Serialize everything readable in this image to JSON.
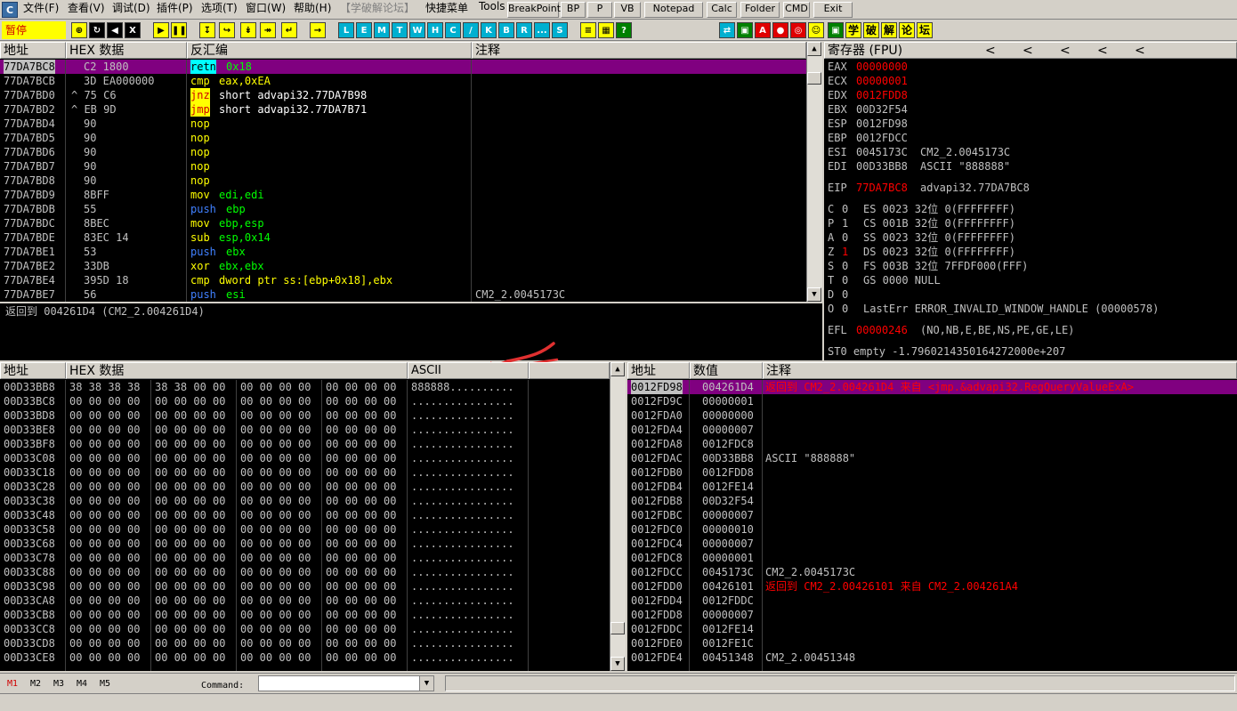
{
  "menu": {
    "items": [
      "文件(F)",
      "查看(V)",
      "调试(D)",
      "插件(P)",
      "选项(T)",
      "窗口(W)",
      "帮助(H)",
      "【学破解论坛】",
      "快捷菜单",
      "Tools"
    ],
    "buttons": [
      "BreakPoint",
      "BP",
      "P",
      "VB",
      "Notepad",
      "Calc",
      "Folder",
      "CMD",
      "Exit"
    ],
    "app_icon": "C"
  },
  "toolbar": {
    "status": "暂停",
    "letters": [
      "L",
      "E",
      "M",
      "T",
      "W",
      "H",
      "C",
      "/",
      "K",
      "B",
      "R",
      "...",
      "S"
    ],
    "cn": [
      "学",
      "破",
      "解",
      "论",
      "坛"
    ]
  },
  "cpu": {
    "headers": {
      "addr": "地址",
      "hex": "HEX 数据",
      "disasm": "反汇编",
      "comment": "注释"
    },
    "rows": [
      {
        "addr": "77DA7BC8",
        "hex": "C2 1800",
        "mnem": "retn",
        "ops": "0x18",
        "comment": "",
        "sel": true
      },
      {
        "addr": "77DA7BCB",
        "hex": "3D EA000000",
        "mnem": "cmp",
        "ops": "eax,0xEA",
        "comment": ""
      },
      {
        "addr": "77DA7BD0",
        "hex": "^ 75 C6",
        "mnem": "jnz",
        "ops": "short advapi32.77DA7B98",
        "comment": ""
      },
      {
        "addr": "77DA7BD2",
        "hex": "^ EB 9D",
        "mnem": "jmp",
        "ops": "short advapi32.77DA7B71",
        "comment": ""
      },
      {
        "addr": "77DA7BD4",
        "hex": "90",
        "mnem": "nop",
        "ops": "",
        "comment": ""
      },
      {
        "addr": "77DA7BD5",
        "hex": "90",
        "mnem": "nop",
        "ops": "",
        "comment": ""
      },
      {
        "addr": "77DA7BD6",
        "hex": "90",
        "mnem": "nop",
        "ops": "",
        "comment": ""
      },
      {
        "addr": "77DA7BD7",
        "hex": "90",
        "mnem": "nop",
        "ops": "",
        "comment": ""
      },
      {
        "addr": "77DA7BD8",
        "hex": "90",
        "mnem": "nop",
        "ops": "",
        "comment": ""
      },
      {
        "addr": "77DA7BD9",
        "hex": "8BFF",
        "mnem": "mov",
        "ops": "edi,edi",
        "comment": ""
      },
      {
        "addr": "77DA7BDB",
        "hex": "55",
        "mnem": "push",
        "ops": "ebp",
        "comment": ""
      },
      {
        "addr": "77DA7BDC",
        "hex": "8BEC",
        "mnem": "mov",
        "ops": "ebp,esp",
        "comment": ""
      },
      {
        "addr": "77DA7BDE",
        "hex": "83EC 14",
        "mnem": "sub",
        "ops": "esp,0x14",
        "comment": ""
      },
      {
        "addr": "77DA7BE1",
        "hex": "53",
        "mnem": "push",
        "ops": "ebx",
        "comment": ""
      },
      {
        "addr": "77DA7BE2",
        "hex": "33DB",
        "mnem": "xor",
        "ops": "ebx,ebx",
        "comment": ""
      },
      {
        "addr": "77DA7BE4",
        "hex": "395D 18",
        "mnem": "cmp",
        "ops": "dword ptr ss:[ebp+0x18],ebx",
        "comment": ""
      },
      {
        "addr": "77DA7BE7",
        "hex": "56",
        "mnem": "push",
        "ops": "esi",
        "comment": "CM2_2.0045173C"
      }
    ],
    "info": "返回到 004261D4 (CM2_2.004261D4)"
  },
  "registers": {
    "header": "寄存器 (FPU)",
    "nav": [
      "<",
      "<",
      "<",
      "<",
      "<"
    ],
    "gp": [
      {
        "name": "EAX",
        "value": "00000000",
        "changed": true,
        "extra": ""
      },
      {
        "name": "ECX",
        "value": "00000001",
        "changed": true,
        "extra": ""
      },
      {
        "name": "EDX",
        "value": "0012FDD8",
        "changed": true,
        "extra": ""
      },
      {
        "name": "EBX",
        "value": "00D32F54",
        "changed": false,
        "extra": ""
      },
      {
        "name": "ESP",
        "value": "0012FD98",
        "changed": false,
        "extra": ""
      },
      {
        "name": "EBP",
        "value": "0012FDCC",
        "changed": false,
        "extra": ""
      },
      {
        "name": "ESI",
        "value": "0045173C",
        "changed": false,
        "extra": "CM2_2.0045173C"
      },
      {
        "name": "EDI",
        "value": "00D33BB8",
        "changed": false,
        "extra": "ASCII \"888888\""
      }
    ],
    "eip": {
      "name": "EIP",
      "value": "77DA7BC8",
      "extra": "advapi32.77DA7BC8"
    },
    "flags": [
      {
        "f": "C",
        "v": "0",
        "red": false,
        "seg": "ES 0023 32位 0(FFFFFFFF)"
      },
      {
        "f": "P",
        "v": "1",
        "red": false,
        "seg": "CS 001B 32位 0(FFFFFFFF)"
      },
      {
        "f": "A",
        "v": "0",
        "red": false,
        "seg": "SS 0023 32位 0(FFFFFFFF)"
      },
      {
        "f": "Z",
        "v": "1",
        "red": true,
        "seg": "DS 0023 32位 0(FFFFFFFF)"
      },
      {
        "f": "S",
        "v": "0",
        "red": false,
        "seg": "FS 003B 32位 7FFDF000(FFF)"
      },
      {
        "f": "T",
        "v": "0",
        "red": false,
        "seg": "GS 0000 NULL"
      },
      {
        "f": "D",
        "v": "0",
        "red": false,
        "seg": ""
      },
      {
        "f": "O",
        "v": "0",
        "red": false,
        "seg": "LastErr ERROR_INVALID_WINDOW_HANDLE (00000578)"
      }
    ],
    "efl": {
      "name": "EFL",
      "value": "00000246",
      "extra": "(NO,NB,E,BE,NS,PE,GE,LE)"
    },
    "st0": "ST0 empty -1.7960214350164272000e+207"
  },
  "dump": {
    "headers": {
      "addr": "地址",
      "hex": "HEX 数据",
      "ascii": "ASCII"
    },
    "rows": [
      {
        "addr": "00D33BB8",
        "hex": [
          "38 38 38 38",
          "38 38 00 00",
          "00 00 00 00",
          "00 00 00 00"
        ],
        "ascii": "888888.........."
      },
      {
        "addr": "00D33BC8",
        "hex": [
          "00 00 00 00",
          "00 00 00 00",
          "00 00 00 00",
          "00 00 00 00"
        ],
        "ascii": "................"
      },
      {
        "addr": "00D33BD8",
        "hex": [
          "00 00 00 00",
          "00 00 00 00",
          "00 00 00 00",
          "00 00 00 00"
        ],
        "ascii": "................"
      },
      {
        "addr": "00D33BE8",
        "hex": [
          "00 00 00 00",
          "00 00 00 00",
          "00 00 00 00",
          "00 00 00 00"
        ],
        "ascii": "................"
      },
      {
        "addr": "00D33BF8",
        "hex": [
          "00 00 00 00",
          "00 00 00 00",
          "00 00 00 00",
          "00 00 00 00"
        ],
        "ascii": "................"
      },
      {
        "addr": "00D33C08",
        "hex": [
          "00 00 00 00",
          "00 00 00 00",
          "00 00 00 00",
          "00 00 00 00"
        ],
        "ascii": "................"
      },
      {
        "addr": "00D33C18",
        "hex": [
          "00 00 00 00",
          "00 00 00 00",
          "00 00 00 00",
          "00 00 00 00"
        ],
        "ascii": "................"
      },
      {
        "addr": "00D33C28",
        "hex": [
          "00 00 00 00",
          "00 00 00 00",
          "00 00 00 00",
          "00 00 00 00"
        ],
        "ascii": "................"
      },
      {
        "addr": "00D33C38",
        "hex": [
          "00 00 00 00",
          "00 00 00 00",
          "00 00 00 00",
          "00 00 00 00"
        ],
        "ascii": "................"
      },
      {
        "addr": "00D33C48",
        "hex": [
          "00 00 00 00",
          "00 00 00 00",
          "00 00 00 00",
          "00 00 00 00"
        ],
        "ascii": "................"
      },
      {
        "addr": "00D33C58",
        "hex": [
          "00 00 00 00",
          "00 00 00 00",
          "00 00 00 00",
          "00 00 00 00"
        ],
        "ascii": "................"
      },
      {
        "addr": "00D33C68",
        "hex": [
          "00 00 00 00",
          "00 00 00 00",
          "00 00 00 00",
          "00 00 00 00"
        ],
        "ascii": "................"
      },
      {
        "addr": "00D33C78",
        "hex": [
          "00 00 00 00",
          "00 00 00 00",
          "00 00 00 00",
          "00 00 00 00"
        ],
        "ascii": "................"
      },
      {
        "addr": "00D33C88",
        "hex": [
          "00 00 00 00",
          "00 00 00 00",
          "00 00 00 00",
          "00 00 00 00"
        ],
        "ascii": "................"
      },
      {
        "addr": "00D33C98",
        "hex": [
          "00 00 00 00",
          "00 00 00 00",
          "00 00 00 00",
          "00 00 00 00"
        ],
        "ascii": "................"
      },
      {
        "addr": "00D33CA8",
        "hex": [
          "00 00 00 00",
          "00 00 00 00",
          "00 00 00 00",
          "00 00 00 00"
        ],
        "ascii": "................"
      },
      {
        "addr": "00D33CB8",
        "hex": [
          "00 00 00 00",
          "00 00 00 00",
          "00 00 00 00",
          "00 00 00 00"
        ],
        "ascii": "................"
      },
      {
        "addr": "00D33CC8",
        "hex": [
          "00 00 00 00",
          "00 00 00 00",
          "00 00 00 00",
          "00 00 00 00"
        ],
        "ascii": "................"
      },
      {
        "addr": "00D33CD8",
        "hex": [
          "00 00 00 00",
          "00 00 00 00",
          "00 00 00 00",
          "00 00 00 00"
        ],
        "ascii": "................"
      },
      {
        "addr": "00D33CE8",
        "hex": [
          "00 00 00 00",
          "00 00 00 00",
          "00 00 00 00",
          "00 00 00 00"
        ],
        "ascii": "................"
      }
    ]
  },
  "stack": {
    "headers": {
      "addr": "地址",
      "value": "数值",
      "comment": "注释"
    },
    "rows": [
      {
        "addr": "0012FD98",
        "value": "004261D4",
        "comment": "返回到 CM2_2.004261D4 来自 <jmp.&advapi32.RegQueryValueExA>",
        "sel": true,
        "red": true
      },
      {
        "addr": "0012FD9C",
        "value": "00000001",
        "comment": ""
      },
      {
        "addr": "0012FDA0",
        "value": "00000000",
        "comment": ""
      },
      {
        "addr": "0012FDA4",
        "value": "00000007",
        "comment": ""
      },
      {
        "addr": "0012FDA8",
        "value": "0012FDC8",
        "comment": ""
      },
      {
        "addr": "0012FDAC",
        "value": "00D33BB8",
        "comment": "ASCII \"888888\""
      },
      {
        "addr": "0012FDB0",
        "value": "0012FDD8",
        "comment": ""
      },
      {
        "addr": "0012FDB4",
        "value": "0012FE14",
        "comment": ""
      },
      {
        "addr": "0012FDB8",
        "value": "00D32F54",
        "comment": ""
      },
      {
        "addr": "0012FDBC",
        "value": "00000007",
        "comment": ""
      },
      {
        "addr": "0012FDC0",
        "value": "00000010",
        "comment": ""
      },
      {
        "addr": "0012FDC4",
        "value": "00000007",
        "comment": ""
      },
      {
        "addr": "0012FDC8",
        "value": "00000001",
        "comment": ""
      },
      {
        "addr": "0012FDCC",
        "value": "0045173C",
        "comment": "CM2_2.0045173C"
      },
      {
        "addr": "0012FDD0",
        "value": "00426101",
        "comment": "返回到 CM2_2.00426101 来自 CM2_2.004261A4",
        "red": true
      },
      {
        "addr": "0012FDD4",
        "value": "0012FDDC",
        "comment": ""
      },
      {
        "addr": "0012FDD8",
        "value": "00000007",
        "comment": ""
      },
      {
        "addr": "0012FDDC",
        "value": "0012FE14",
        "comment": ""
      },
      {
        "addr": "0012FDE0",
        "value": "0012FE1C",
        "comment": ""
      },
      {
        "addr": "0012FDE4",
        "value": "00451348",
        "comment": "CM2_2.00451348"
      }
    ]
  },
  "bottom": {
    "tabs": [
      "M1",
      "M2",
      "M3",
      "M4",
      "M5"
    ],
    "command_label": "Command:",
    "command_value": ""
  },
  "colors": {
    "selected_row": "#800080",
    "changed_reg": "#ff0000",
    "arrow": "#e03030"
  }
}
